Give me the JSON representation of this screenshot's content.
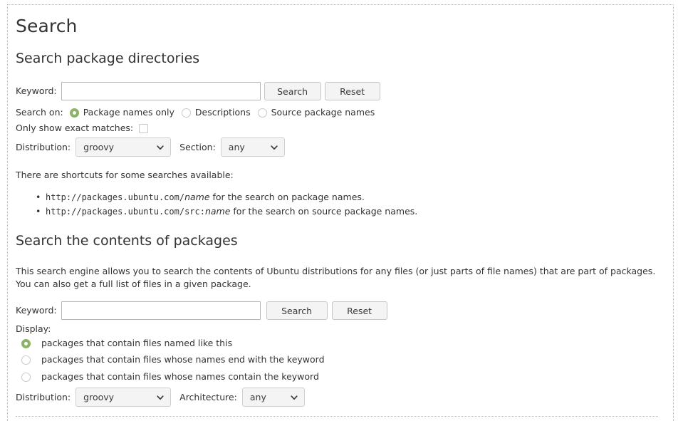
{
  "page": {
    "title": "Search"
  },
  "package_search": {
    "heading": "Search package directories",
    "keyword_label": "Keyword:",
    "keyword_value": "",
    "keyword_placeholder": "",
    "search_button": "Search",
    "reset_button": "Reset",
    "search_on_label": "Search on:",
    "search_on_options": [
      {
        "label": "Package names only",
        "selected": true
      },
      {
        "label": "Descriptions",
        "selected": false
      },
      {
        "label": "Source package names",
        "selected": false
      }
    ],
    "exact_matches_label": "Only show exact matches:",
    "exact_matches_checked": false,
    "distribution_label": "Distribution:",
    "distribution_value": "groovy",
    "section_label": "Section:",
    "section_value": "any",
    "shortcuts_intro": "There are shortcuts for some searches available:",
    "shortcuts": [
      {
        "url_prefix": "http://packages.ubuntu.com/",
        "url_variable": "name",
        "suffix": " for the search on package names."
      },
      {
        "url_prefix": "http://packages.ubuntu.com/src:",
        "url_variable": "name",
        "suffix": " for the search on source package names."
      }
    ]
  },
  "contents_search": {
    "heading": "Search the contents of packages",
    "description": "This search engine allows you to search the contents of Ubuntu distributions for any files (or just parts of file names) that are part of packages. You can also get a full list of files in a given package.",
    "keyword_label": "Keyword:",
    "keyword_value": "",
    "keyword_placeholder": "",
    "search_button": "Search",
    "reset_button": "Reset",
    "display_label": "Display:",
    "display_options": [
      {
        "label": "packages that contain files named like this",
        "selected": true
      },
      {
        "label": "packages that contain files whose names end with the keyword",
        "selected": false
      },
      {
        "label": "packages that contain files whose names contain the keyword",
        "selected": false
      }
    ],
    "distribution_label": "Distribution:",
    "distribution_value": "groovy",
    "architecture_label": "Architecture:",
    "architecture_value": "any"
  },
  "colors": {
    "accent_green": "#8cb265",
    "text": "#333333",
    "border": "#c8c8c8",
    "button_bg": "#f4f4f4"
  }
}
